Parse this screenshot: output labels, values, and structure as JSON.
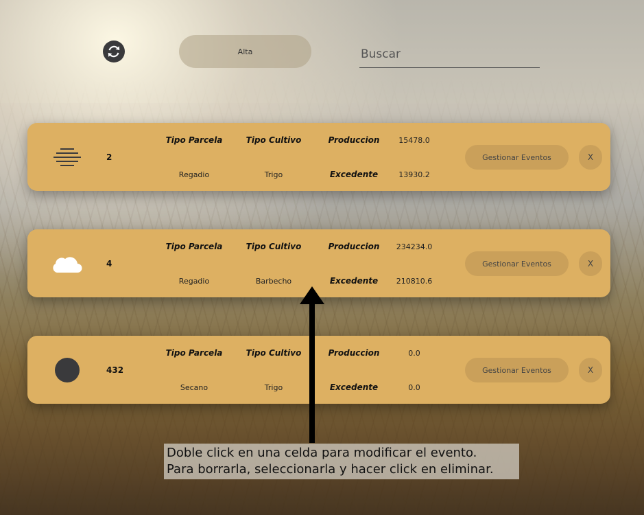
{
  "toolbar": {
    "refresh_icon": "refresh-icon",
    "alta_label": "Alta",
    "search_placeholder": "Buscar"
  },
  "headers": {
    "tipo_parcela": "Tipo Parcela",
    "tipo_cultivo": "Tipo Cultivo",
    "produccion": "Produccion",
    "excedente": "Excedente"
  },
  "cards": [
    {
      "icon": "fog-icon",
      "id": "2",
      "tipo_parcela": "Regadio",
      "tipo_cultivo": "Trigo",
      "produccion": "15478.0",
      "excedente": "13930.2",
      "gestionar_label": "Gestionar Eventos",
      "close_label": "X"
    },
    {
      "icon": "cloud-icon",
      "id": "4",
      "tipo_parcela": "Regadio",
      "tipo_cultivo": "Barbecho",
      "produccion": "234234.0",
      "excedente": "210810.6",
      "gestionar_label": "Gestionar Eventos",
      "close_label": "X"
    },
    {
      "icon": "circle-icon",
      "id": "432",
      "tipo_parcela": "Secano",
      "tipo_cultivo": "Trigo",
      "produccion": "0.0",
      "excedente": "0.0",
      "gestionar_label": "Gestionar Eventos",
      "close_label": "X"
    }
  ],
  "tooltip": {
    "line1": "Doble click en una celda para modificar el evento.",
    "line2": "Para borrarla, seleccionarla y hacer click en eliminar."
  },
  "colors": {
    "card": "#ddb062",
    "button": "#caa05a",
    "icon_dark": "#3a3a3c"
  }
}
